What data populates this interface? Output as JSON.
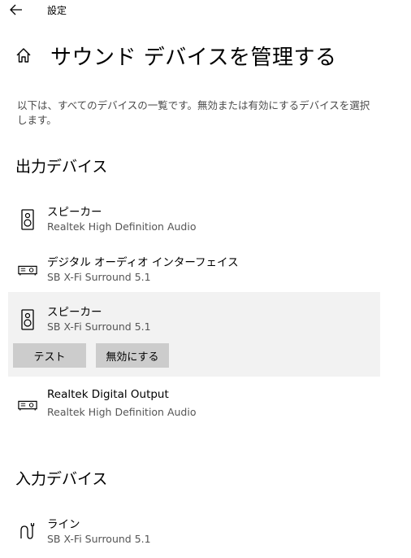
{
  "window": {
    "title": "設定"
  },
  "header": {
    "title": "サウンド デバイスを管理する"
  },
  "description": "以下は、すべてのデバイスの一覧です。無効または有効にするデバイスを選択します。",
  "output_section": {
    "heading": "出力デバイス",
    "devices": [
      {
        "name": "スピーカー",
        "subtitle": "Realtek High Definition Audio",
        "icon": "speaker-icon"
      },
      {
        "name": "デジタル オーディオ インターフェイス",
        "subtitle": "SB X-Fi Surround 5.1",
        "icon": "digital-audio-icon"
      },
      {
        "name": "スピーカー",
        "subtitle": "SB X-Fi Surround 5.1",
        "icon": "speaker-icon",
        "selected": true
      },
      {
        "name": "Realtek Digital Output",
        "subtitle": "Realtek High Definition Audio",
        "icon": "digital-audio-icon"
      }
    ],
    "buttons": {
      "test_label": "テスト",
      "disable_label": "無効にする"
    }
  },
  "input_section": {
    "heading": "入力デバイス",
    "devices": [
      {
        "name": "ライン",
        "subtitle": "SB X-Fi Surround 5.1",
        "icon": "line-in-icon"
      }
    ]
  },
  "colors": {
    "selected_bg": "#f2f2f2",
    "button_bg": "#cccccc"
  }
}
